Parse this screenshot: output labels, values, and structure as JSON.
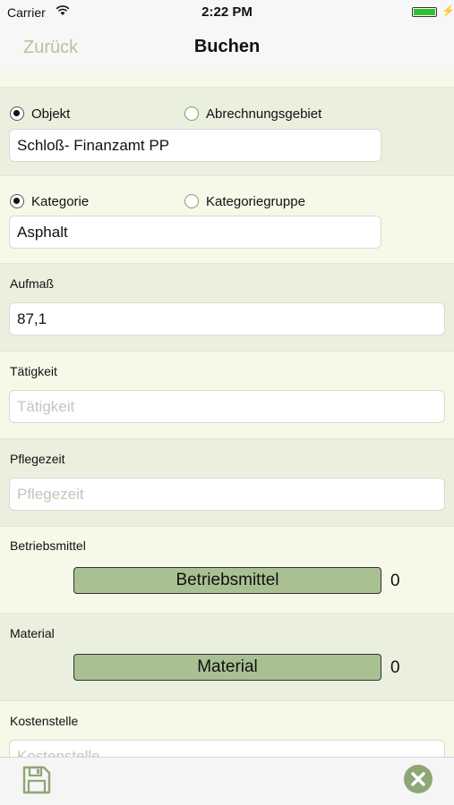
{
  "status": {
    "carrier": "Carrier",
    "time": "2:22 PM"
  },
  "nav": {
    "back": "Zurück",
    "title": "Buchen"
  },
  "objekt_section": {
    "option1": "Objekt",
    "option2": "Abrechnungsgebiet",
    "selected": "Objekt",
    "value": "Schloß- Finanzamt PP"
  },
  "kategorie_section": {
    "option1": "Kategorie",
    "option2": "Kategoriegruppe",
    "selected": "Kategorie",
    "value": "Asphalt"
  },
  "aufmass": {
    "label": "Aufmaß",
    "value": "87,1"
  },
  "taetigkeit": {
    "label": "Tätigkeit",
    "placeholder": "Tätigkeit"
  },
  "pflegezeit": {
    "label": "Pflegezeit",
    "placeholder": "Pflegezeit"
  },
  "betriebsmittel": {
    "label": "Betriebsmittel",
    "button": "Betriebsmittel",
    "count": "0"
  },
  "material": {
    "label": "Material",
    "button": "Material",
    "count": "0"
  },
  "kostenstelle": {
    "label": "Kostenstelle",
    "placeholder": "Kostenstelle"
  },
  "colors": {
    "accent": "#a9c093",
    "back_text": "#b4c39c",
    "icon": "#8fa676"
  },
  "icons": {
    "save": "floppy-disk-icon",
    "close": "close-circle-icon"
  }
}
